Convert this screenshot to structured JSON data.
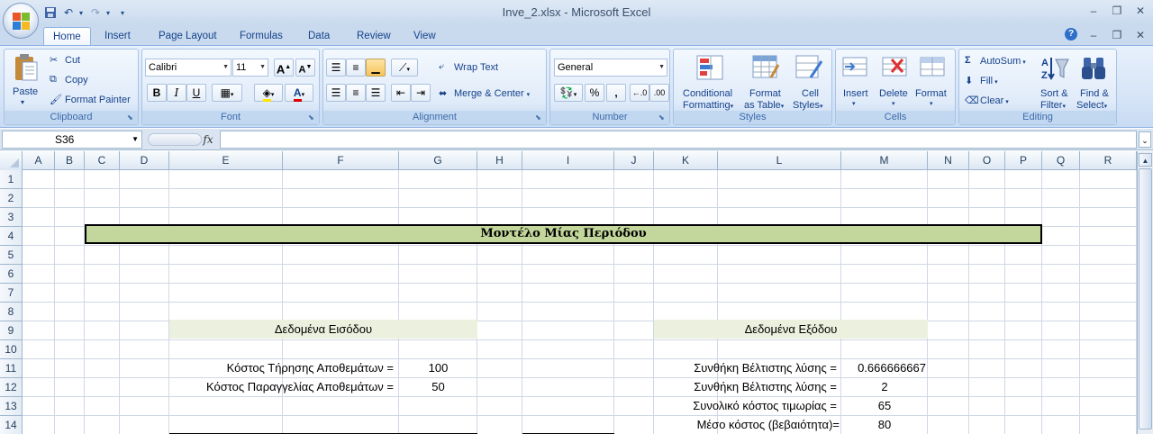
{
  "window": {
    "title": "Inve_2.xlsx - Microsoft Excel"
  },
  "tabs": [
    {
      "label": "Home"
    },
    {
      "label": "Insert"
    },
    {
      "label": "Page Layout"
    },
    {
      "label": "Formulas"
    },
    {
      "label": "Data"
    },
    {
      "label": "Review"
    },
    {
      "label": "View"
    }
  ],
  "ribbon": {
    "clipboard": {
      "label": "Clipboard",
      "paste": "Paste",
      "cut": "Cut",
      "copy": "Copy",
      "format_painter": "Format Painter"
    },
    "font": {
      "label": "Font",
      "font_name": "Calibri",
      "font_size": "11",
      "bold": "B",
      "italic": "I",
      "underline": "U"
    },
    "alignment": {
      "label": "Alignment",
      "wrap_text": "Wrap Text",
      "merge_center": "Merge & Center"
    },
    "number": {
      "label": "Number",
      "format": "General"
    },
    "styles": {
      "label": "Styles",
      "conditional": "Conditional",
      "conditional2": "Formatting",
      "format_table": "Format",
      "format_table2": "as Table",
      "cell_styles": "Cell",
      "cell_styles2": "Styles"
    },
    "cells": {
      "label": "Cells",
      "insert": "Insert",
      "delete": "Delete",
      "format": "Format"
    },
    "editing": {
      "label": "Editing",
      "autosum": "AutoSum",
      "fill": "Fill",
      "clear": "Clear",
      "sort": "Sort &",
      "sort2": "Filter",
      "find": "Find &",
      "find2": "Select"
    }
  },
  "formula_bar": {
    "name_box": "S36",
    "fx": "fx",
    "formula": ""
  },
  "columns": [
    "A",
    "B",
    "C",
    "D",
    "E",
    "F",
    "G",
    "H",
    "I",
    "J",
    "K",
    "L",
    "M",
    "N",
    "O",
    "P",
    "Q",
    "R"
  ],
  "rows": [
    "1",
    "2",
    "3",
    "4",
    "5",
    "6",
    "7",
    "8",
    "9",
    "10",
    "11",
    "12",
    "13",
    "14"
  ],
  "sheet": {
    "title": "Μοντέλο Μίας Περιόδου",
    "input_header": "Δεδομένα Εισόδου",
    "output_header": "Δεδομένα Εξόδου",
    "inputs": [
      {
        "label": "Κόστος Τήρησης Αποθεμάτων =",
        "value": "100"
      },
      {
        "label": "Κόστος Παραγγελίας Αποθεμάτων =",
        "value": "50"
      }
    ],
    "outputs": [
      {
        "label": "Συνθήκη Βέλτιστης λύσης =",
        "value": "0.666666667"
      },
      {
        "label": "Συνθήκη Βέλτιστης λύσης =",
        "value": "2"
      },
      {
        "label": "Συνολικό κόστος τιμωρίας =",
        "value": "65"
      },
      {
        "label": "Μέσο κόστος (βεβαιότητα)=",
        "value": "80"
      }
    ]
  },
  "colors": {
    "title_band": "#c3d69b",
    "section_band": "#ebf1de",
    "accent": "#15428b"
  }
}
